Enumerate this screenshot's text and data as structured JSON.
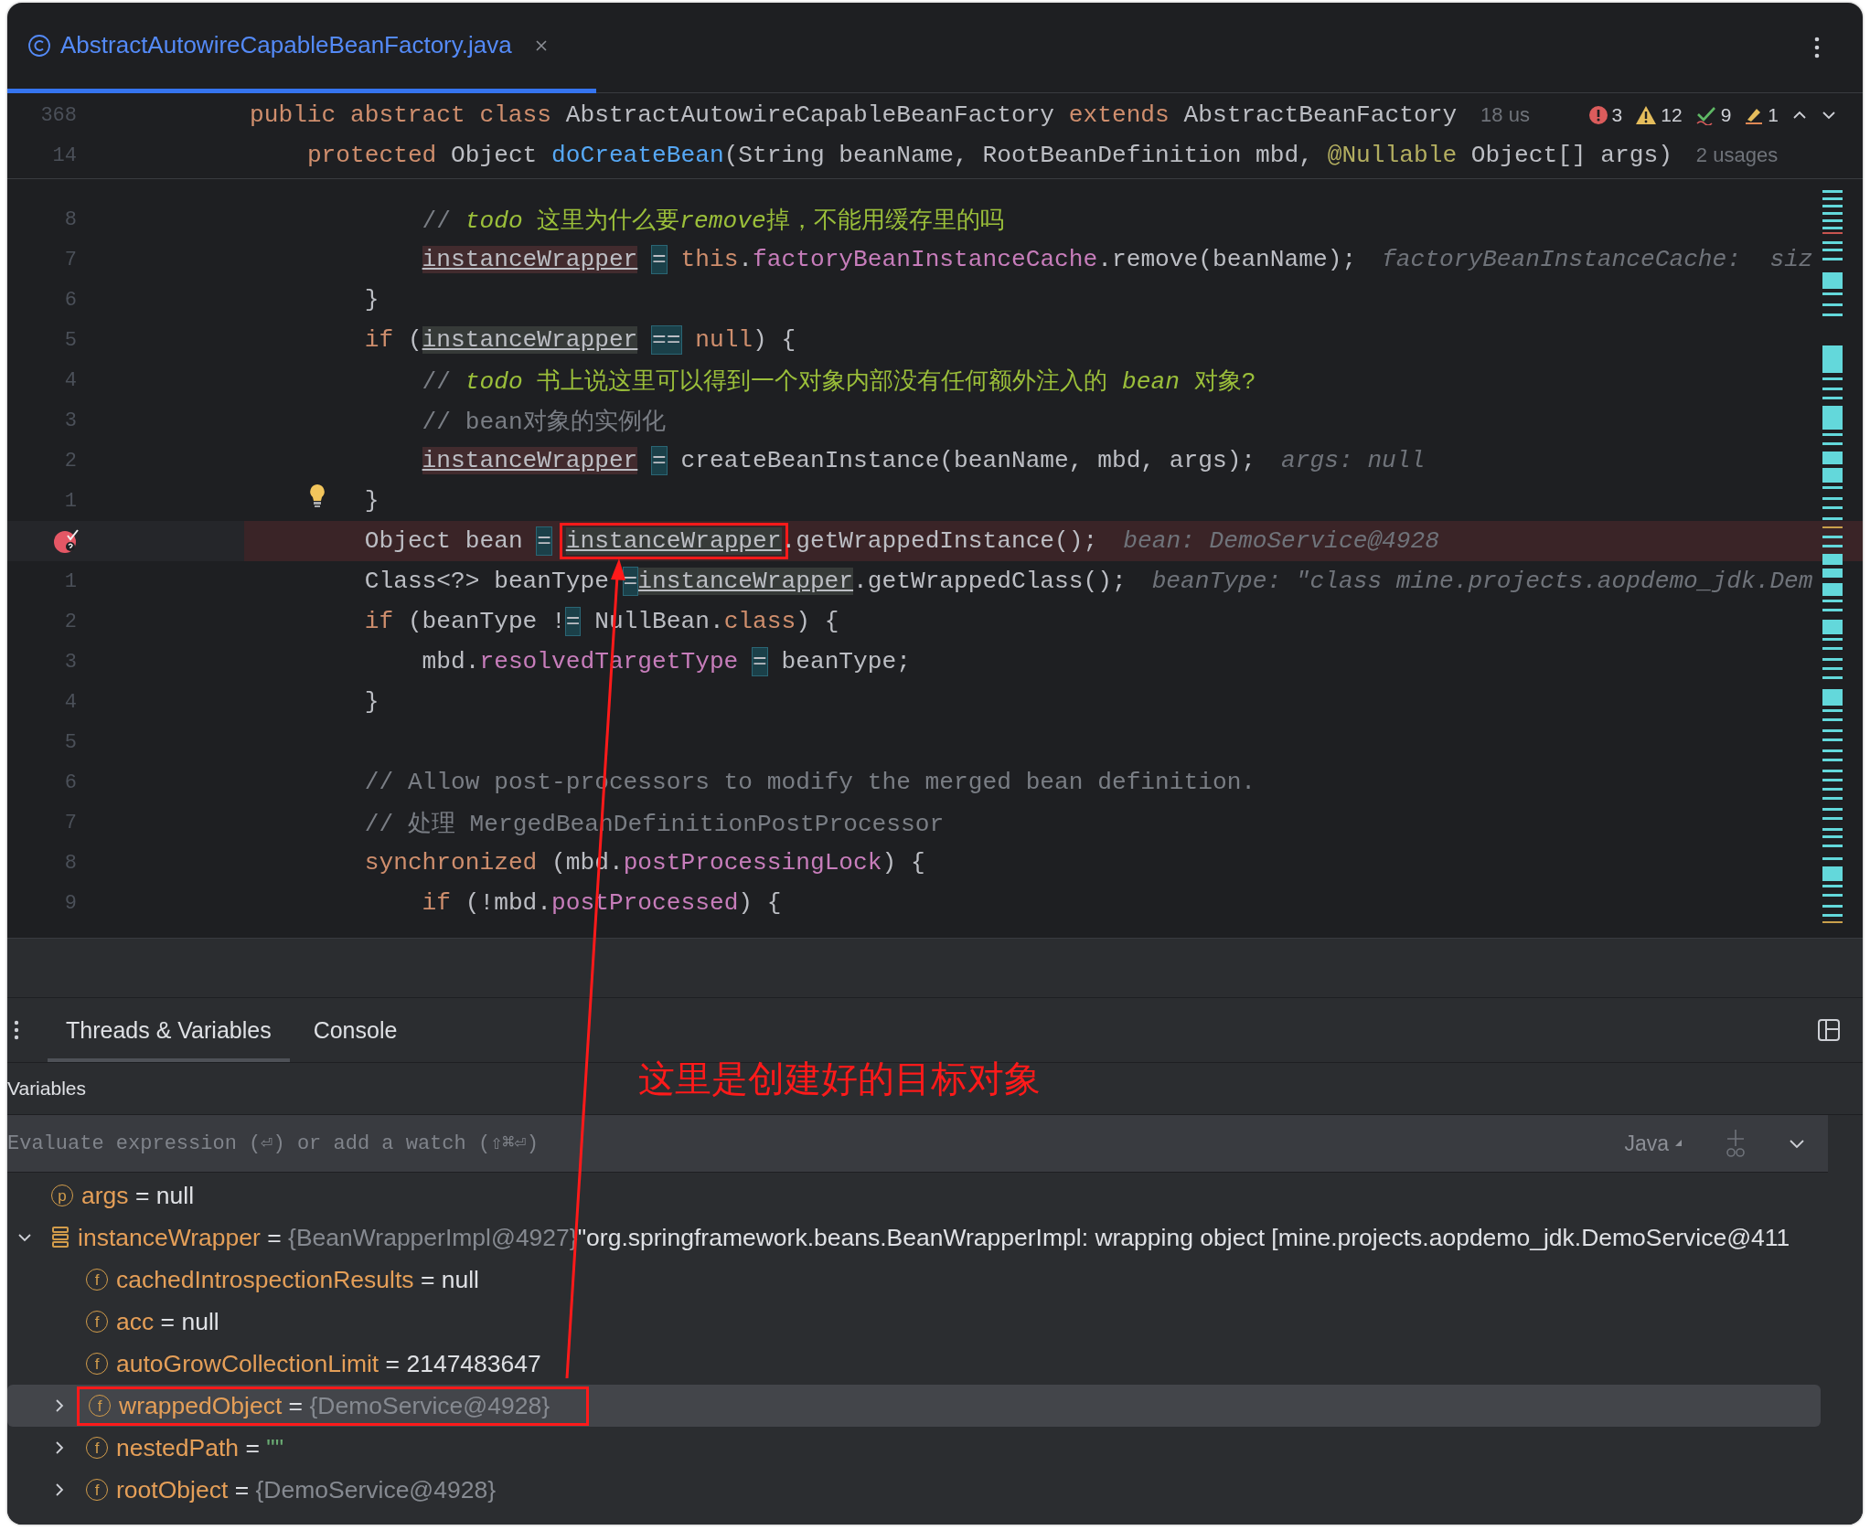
{
  "editor_tab": {
    "title": "AbstractAutowireCapableBeanFactory.java",
    "selected": true
  },
  "sticky_lines": [
    {
      "number": "368",
      "segments": [
        {
          "kind": "keyword",
          "text": "public abstract class"
        },
        {
          "kind": "plain",
          "text": " AbstractAutowireCapableBeanFactory "
        },
        {
          "kind": "keyword",
          "text": "extends"
        },
        {
          "kind": "plain",
          "text": " AbstractBeanFactory"
        }
      ],
      "usages": "18 us",
      "inspections": [
        {
          "kind": "error",
          "count": "3"
        },
        {
          "kind": "warning",
          "count": "12"
        },
        {
          "kind": "ok",
          "count": "9"
        },
        {
          "kind": "typo",
          "count": "1"
        }
      ]
    },
    {
      "number": "14",
      "segments": [
        {
          "kind": "keyword",
          "text": "    protected"
        },
        {
          "kind": "plain",
          "text": " Object "
        },
        {
          "kind": "method",
          "text": "doCreateBean"
        },
        {
          "kind": "plain",
          "text": "(String beanName, RootBeanDefinition mbd, "
        },
        {
          "kind": "annotation",
          "text": "@Nullable"
        },
        {
          "kind": "plain",
          "text": " Object[] args)"
        }
      ],
      "usages": "2 usages"
    }
  ],
  "code_lines": [
    {
      "number": "8",
      "current": false,
      "breakpoint": false,
      "bulb": false,
      "segments": [
        {
          "kind": "comment",
          "text": "            // "
        },
        {
          "kind": "todo_italic",
          "text": "todo"
        },
        {
          "kind": "todo",
          "text": " 这里为什么要"
        },
        {
          "kind": "todo_italic",
          "text": "remove"
        },
        {
          "kind": "todo",
          "text": "掉，不能用缓存里的吗"
        }
      ]
    },
    {
      "number": "7",
      "current": false,
      "breakpoint": false,
      "bulb": false,
      "segments": [
        {
          "kind": "var_write",
          "text": "            instanceWrapper"
        },
        {
          "kind": "operator",
          "text": " = "
        },
        {
          "kind": "keyword",
          "text": "this"
        },
        {
          "kind": "plain",
          "text": "."
        },
        {
          "kind": "field",
          "text": "factoryBeanInstanceCache"
        },
        {
          "kind": "plain",
          "text": ".remove(beanName);"
        },
        {
          "kind": "hint",
          "text": "factoryBeanInstanceCache:  siz"
        }
      ]
    },
    {
      "number": "6",
      "current": false,
      "breakpoint": false,
      "bulb": false,
      "segments": [
        {
          "kind": "plain",
          "text": "        }"
        }
      ]
    },
    {
      "number": "5",
      "current": false,
      "breakpoint": false,
      "bulb": false,
      "segments": [
        {
          "kind": "keyword",
          "text": "        if"
        },
        {
          "kind": "plain",
          "text": " ("
        },
        {
          "kind": "var_read",
          "text": "instanceWrapper"
        },
        {
          "kind": "operator",
          "text": " == "
        },
        {
          "kind": "keyword",
          "text": "null"
        },
        {
          "kind": "plain",
          "text": ") {"
        }
      ]
    },
    {
      "number": "4",
      "current": false,
      "breakpoint": false,
      "bulb": false,
      "segments": [
        {
          "kind": "comment",
          "text": "            // "
        },
        {
          "kind": "todo_italic",
          "text": "todo"
        },
        {
          "kind": "todo",
          "text": " 书上说这里可以得到一个对象内部没有任何额外注入的 "
        },
        {
          "kind": "todo_italic",
          "text": "bean"
        },
        {
          "kind": "todo",
          "text": " 对象?"
        }
      ]
    },
    {
      "number": "3",
      "current": false,
      "breakpoint": false,
      "bulb": false,
      "segments": [
        {
          "kind": "comment",
          "text": "            // bean对象的实例化"
        }
      ]
    },
    {
      "number": "2",
      "current": false,
      "breakpoint": false,
      "bulb": false,
      "segments": [
        {
          "kind": "var_write",
          "text": "            instanceWrapper"
        },
        {
          "kind": "operator",
          "text": " = "
        },
        {
          "kind": "plain",
          "text": "createBeanInstance(beanName, mbd, args);"
        },
        {
          "kind": "hint",
          "text": "args: null"
        }
      ]
    },
    {
      "number": "1",
      "current": false,
      "breakpoint": false,
      "bulb": true,
      "segments": [
        {
          "kind": "plain",
          "text": "        }"
        }
      ]
    },
    {
      "current": true,
      "breakpoint": true,
      "bulb": false,
      "segments": [
        {
          "kind": "plain",
          "text": "        Object bean "
        },
        {
          "kind": "operator",
          "text": "= "
        },
        {
          "kind": "var_read",
          "text": "instanceWrapper",
          "boxed": true
        },
        {
          "kind": "plain",
          "text": ".getWrappedInstance();"
        },
        {
          "kind": "hint",
          "text": "bean: DemoService@4928"
        }
      ]
    },
    {
      "number": "1",
      "current": false,
      "breakpoint": false,
      "bulb": false,
      "segments": [
        {
          "kind": "plain",
          "text": "        Class<?> beanType "
        },
        {
          "kind": "operator",
          "text": "="
        },
        {
          "kind": "var_read",
          "text": "instanceWrapper"
        },
        {
          "kind": "plain",
          "text": ".getWrappedClass();"
        },
        {
          "kind": "hint",
          "text": "beanType: \"class mine.projects.aopdemo_jdk.Dem"
        }
      ]
    },
    {
      "number": "2",
      "current": false,
      "breakpoint": false,
      "bulb": false,
      "segments": [
        {
          "kind": "keyword",
          "text": "        if"
        },
        {
          "kind": "plain",
          "text": " (beanType !"
        },
        {
          "kind": "operator",
          "text": "="
        },
        {
          "kind": "plain",
          "text": " NullBean."
        },
        {
          "kind": "keyword",
          "text": "class"
        },
        {
          "kind": "plain",
          "text": ") {"
        }
      ]
    },
    {
      "number": "3",
      "current": false,
      "breakpoint": false,
      "bulb": false,
      "segments": [
        {
          "kind": "plain",
          "text": "            mbd."
        },
        {
          "kind": "field",
          "text": "resolvedTargetType"
        },
        {
          "kind": "operator",
          "text": " = "
        },
        {
          "kind": "plain",
          "text": "beanType;"
        }
      ]
    },
    {
      "number": "4",
      "current": false,
      "breakpoint": false,
      "bulb": false,
      "segments": [
        {
          "kind": "plain",
          "text": "        }"
        }
      ]
    },
    {
      "number": "5",
      "current": false,
      "breakpoint": false,
      "bulb": false
    },
    {
      "number": "6",
      "current": false,
      "breakpoint": false,
      "bulb": false,
      "segments": [
        {
          "kind": "comment",
          "text": "        // Allow post-processors to modify the merged bean definition."
        }
      ]
    },
    {
      "number": "7",
      "current": false,
      "breakpoint": false,
      "bulb": false,
      "segments": [
        {
          "kind": "comment",
          "text": "        // 处理 MergedBeanDefinitionPostProcessor"
        }
      ]
    },
    {
      "number": "8",
      "current": false,
      "breakpoint": false,
      "bulb": false,
      "segments": [
        {
          "kind": "keyword",
          "text": "        synchronized"
        },
        {
          "kind": "plain",
          "text": " (mbd."
        },
        {
          "kind": "field",
          "text": "postProcessingLock"
        },
        {
          "kind": "plain",
          "text": ") {"
        }
      ]
    },
    {
      "number": "9",
      "current": false,
      "breakpoint": false,
      "bulb": false,
      "segments": [
        {
          "kind": "keyword",
          "text": "            if"
        },
        {
          "kind": "plain",
          "text": " (!mbd."
        },
        {
          "kind": "field",
          "text": "postProcessed"
        },
        {
          "kind": "plain",
          "text": ") {"
        }
      ]
    }
  ],
  "debug_panel": {
    "tabs": [
      {
        "label": "Threads & Variables",
        "selected": true
      },
      {
        "label": "Console",
        "selected": false
      }
    ],
    "section_label": "Variables",
    "evaluate": {
      "placeholder": "Evaluate expression (⏎) or add a watch (⇧⌘⏎)",
      "language": "Java"
    },
    "variables": [
      {
        "kind": "parameter",
        "badge": "p",
        "name": "args",
        "op": "=",
        "value": "null",
        "is_string": false,
        "selected": false
      },
      {
        "kind": "object",
        "name": "instanceWrapper",
        "op": "=",
        "type_label": "{BeanWrapperImpl@4927}",
        "value": "\"org.springframework.beans.BeanWrapperImpl: wrapping object [mine.projects.aopdemo_jdk.DemoService@411",
        "is_string": false,
        "expanded": true,
        "selected": false,
        "children": [
          {
            "kind": "field",
            "badge": "f",
            "name": "cachedIntrospectionResults",
            "op": "=",
            "value": "null",
            "is_string": false,
            "selected": false
          },
          {
            "kind": "field",
            "badge": "f",
            "name": "acc",
            "op": "=",
            "value": "null",
            "is_string": false,
            "selected": false
          },
          {
            "kind": "field",
            "badge": "f",
            "name": "autoGrowCollectionLimit",
            "op": "=",
            "value": "2147483647",
            "is_string": false,
            "selected": false
          },
          {
            "kind": "field",
            "badge": "f",
            "name": "wrappedObject",
            "op": "=",
            "type_label": "{DemoService@4928}",
            "expanded": false,
            "selected": true,
            "boxed": true
          },
          {
            "kind": "field",
            "badge": "f",
            "name": "nestedPath",
            "op": "=",
            "value": "\"\"",
            "is_string": true,
            "expanded": false,
            "selected": false
          },
          {
            "kind": "field",
            "badge": "f",
            "name": "rootObject",
            "op": "=",
            "type_label": "{DemoService@4928}",
            "expanded": false,
            "selected": false
          }
        ]
      }
    ]
  },
  "annotation": {
    "note": "这里是创建好的目标对象",
    "arrow": true
  }
}
